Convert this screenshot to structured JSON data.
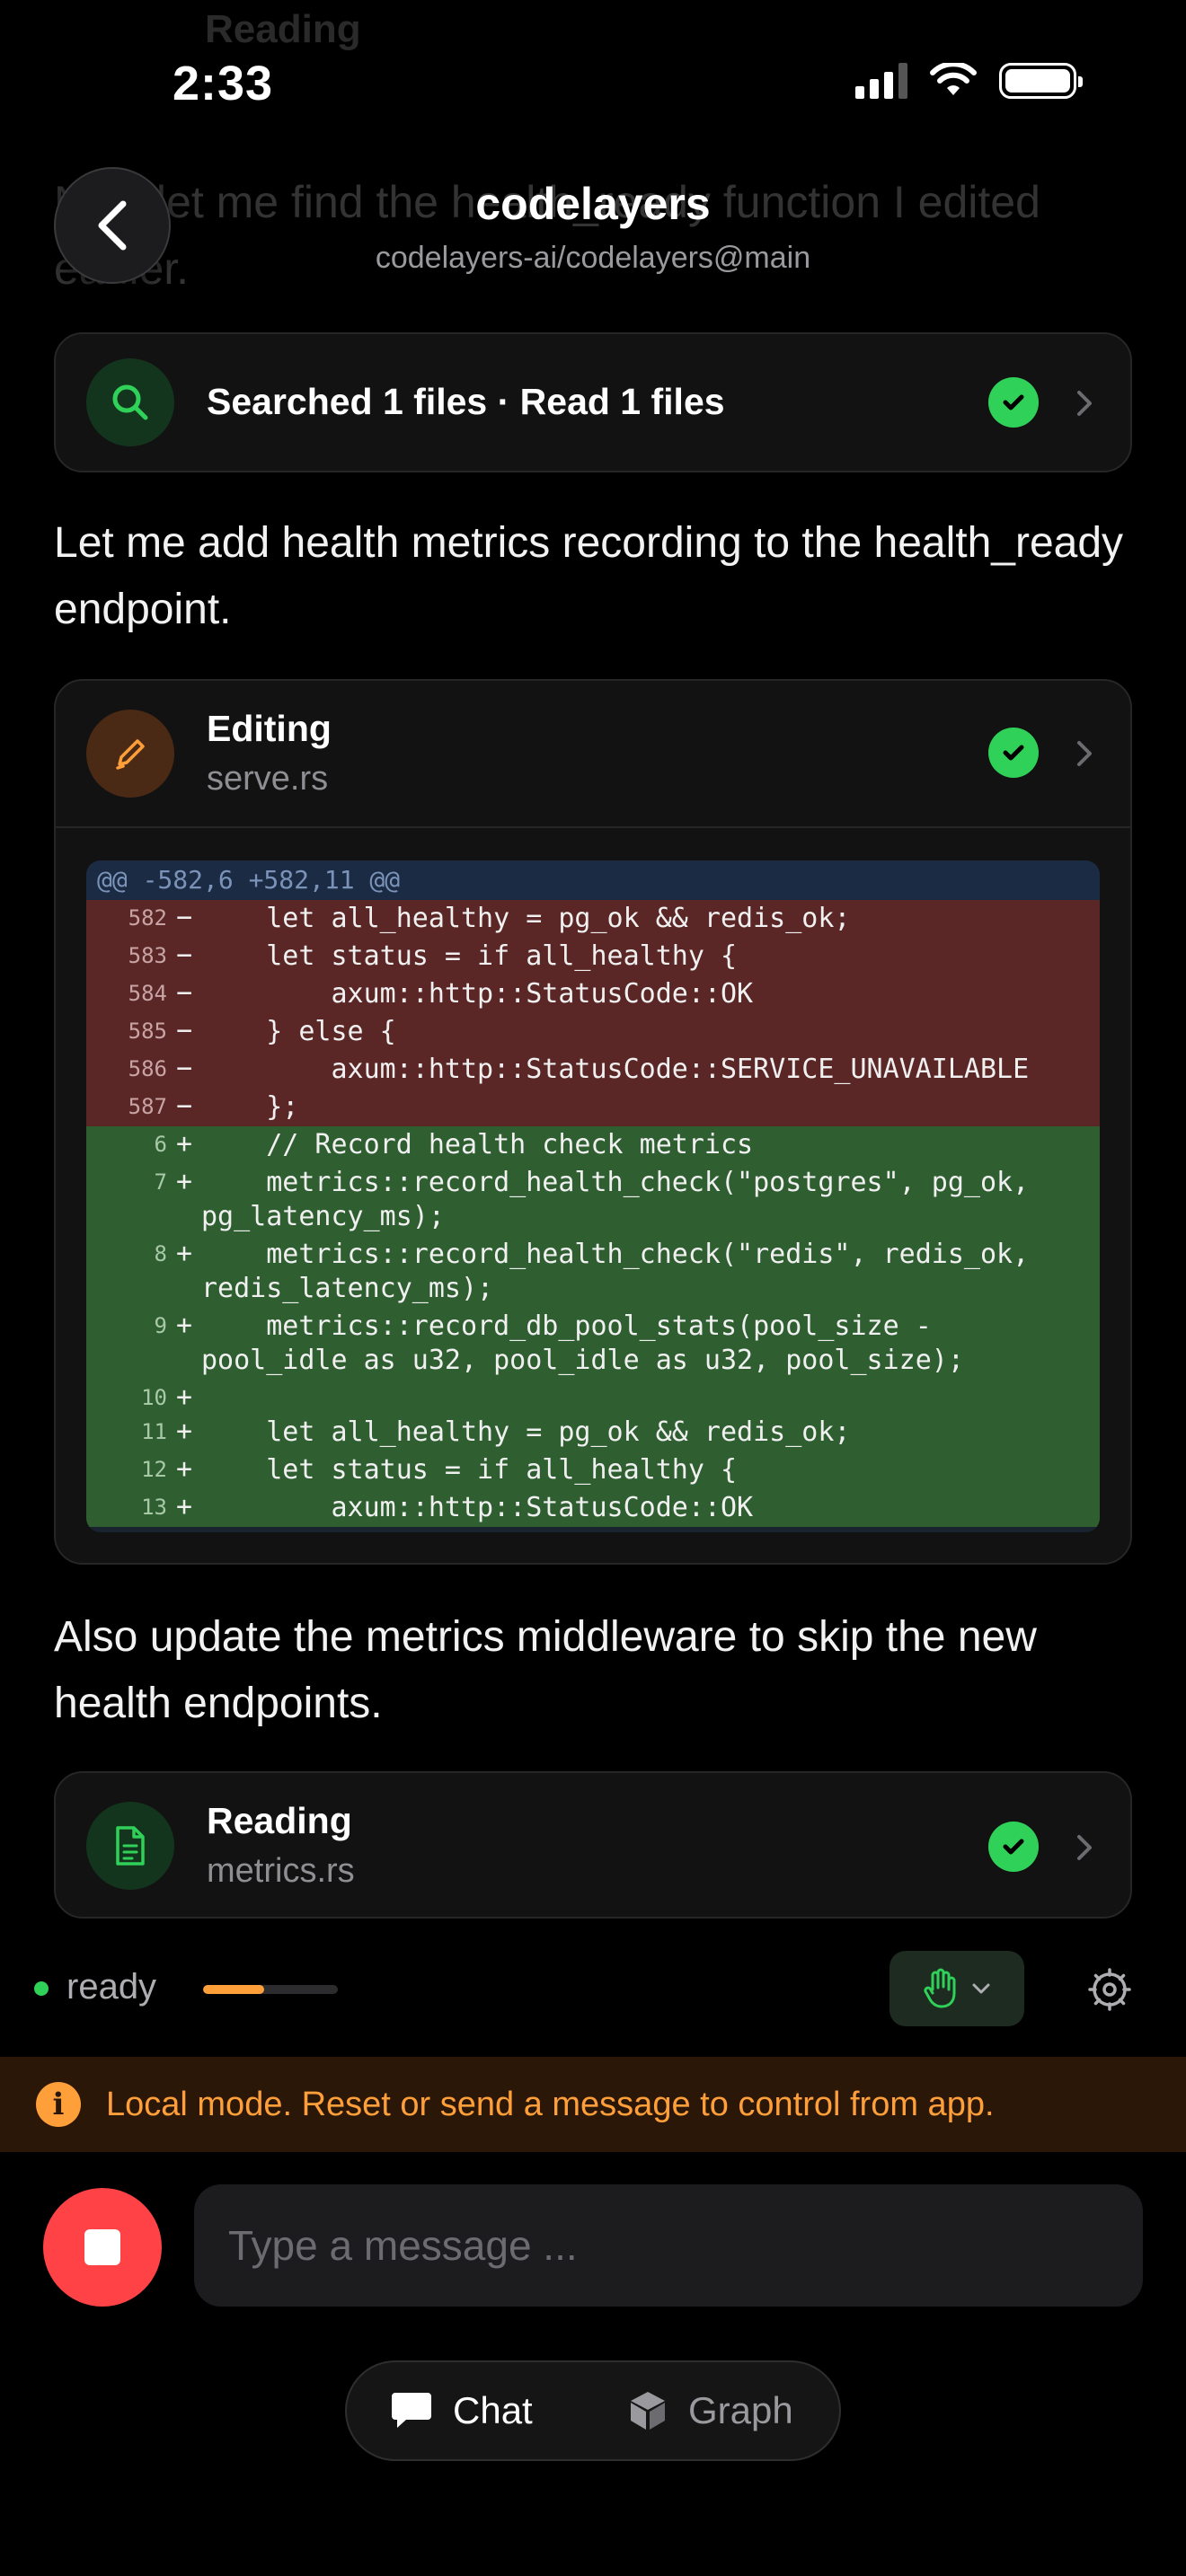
{
  "status_bar": {
    "time": "2:33"
  },
  "background_ghost": {
    "top_title": "Reading",
    "behind_header": "Now let me find the health_ready function I edited earlier."
  },
  "header": {
    "title": "codelayers",
    "subtitle": "codelayers-ai/codelayers@main"
  },
  "cards": {
    "search": {
      "title": "Searched 1 files · Read 1 files",
      "status": "done"
    },
    "edit": {
      "title": "Editing",
      "file": "serve.rs",
      "status": "done"
    },
    "read": {
      "title": "Reading",
      "file": "metrics.rs",
      "status": "done"
    }
  },
  "messages": {
    "m1": "Let me add health metrics recording to the health_ready endpoint.",
    "m2": "Also update the metrics middleware to skip the new health endpoints."
  },
  "diff": {
    "hunk_header": "@@ -582,6 +582,11 @@",
    "lines": [
      {
        "n": "582",
        "sign": "−",
        "code": "    let all_healthy = pg_ok && redis_ok;"
      },
      {
        "n": "583",
        "sign": "−",
        "code": "    let status = if all_healthy {"
      },
      {
        "n": "584",
        "sign": "−",
        "code": "        axum::http::StatusCode::OK"
      },
      {
        "n": "585",
        "sign": "−",
        "code": "    } else {"
      },
      {
        "n": "586",
        "sign": "−",
        "code": "        axum::http::StatusCode::SERVICE_UNAVAILABLE"
      },
      {
        "n": "587",
        "sign": "−",
        "code": "    };"
      },
      {
        "n": "6",
        "sign": "+",
        "code": "    // Record health check metrics"
      },
      {
        "n": "7",
        "sign": "+",
        "code": "    metrics::record_health_check(\"postgres\", pg_ok, pg_latency_ms);"
      },
      {
        "n": "8",
        "sign": "+",
        "code": "    metrics::record_health_check(\"redis\", redis_ok, redis_latency_ms);"
      },
      {
        "n": "9",
        "sign": "+",
        "code": "    metrics::record_db_pool_stats(pool_size - pool_idle as u32, pool_idle as u32, pool_size);"
      },
      {
        "n": "10",
        "sign": "+",
        "code": ""
      },
      {
        "n": "11",
        "sign": "+",
        "code": "    let all_healthy = pg_ok && redis_ok;"
      },
      {
        "n": "12",
        "sign": "+",
        "code": "    let status = if all_healthy {"
      },
      {
        "n": "13",
        "sign": "+",
        "code": "        axum::http::StatusCode::OK"
      }
    ]
  },
  "controls": {
    "status_label": "ready",
    "progress_fraction": 0.45
  },
  "banner": {
    "icon": "i",
    "text": "Local mode. Reset or send a message to control from app."
  },
  "composer": {
    "placeholder": "Type a message ..."
  },
  "tabs": {
    "chat": "Chat",
    "graph": "Graph"
  },
  "colors": {
    "accent_green": "#30d158",
    "accent_orange": "#ff9f3a",
    "stop_red": "#ff4245",
    "diff_removed": "#5a2626",
    "diff_added": "#2f5f31"
  },
  "icons": [
    "back-chevron-icon",
    "search-icon",
    "pencil-icon",
    "document-icon",
    "check-icon",
    "chevron-right-icon",
    "hand-icon",
    "chevron-down-icon",
    "settings-icon",
    "info-icon",
    "stop-icon",
    "chat-bubble-icon",
    "cube-icon"
  ]
}
